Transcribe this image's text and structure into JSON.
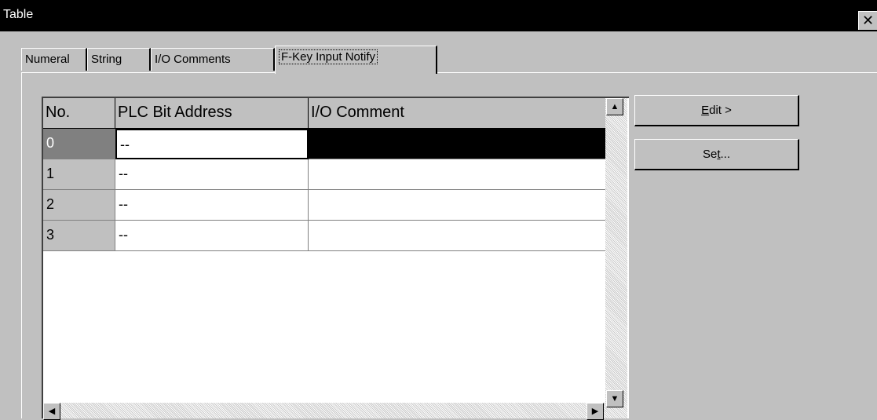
{
  "window": {
    "title": "Table",
    "close_glyph": "✕"
  },
  "tabs": [
    {
      "label": "Numeral"
    },
    {
      "label": "String"
    },
    {
      "label": "I/O Comments"
    },
    {
      "label": "F-Key Input Notify",
      "active": true
    }
  ],
  "grid": {
    "columns": [
      "No.",
      "PLC Bit  Address",
      "I/O Comment"
    ],
    "rows": [
      {
        "no": "0",
        "address": "--",
        "comment": ""
      },
      {
        "no": "1",
        "address": "--",
        "comment": ""
      },
      {
        "no": "2",
        "address": "--",
        "comment": ""
      },
      {
        "no": "3",
        "address": "--",
        "comment": ""
      }
    ],
    "selected_row": 0
  },
  "scroll": {
    "up": "▲",
    "down": "▼",
    "left": "◀",
    "right": "▶"
  },
  "buttons": {
    "edit": {
      "accel": "E",
      "rest": "dit >"
    },
    "set": {
      "pre": "Se",
      "accel": "t",
      "rest": "..."
    }
  }
}
